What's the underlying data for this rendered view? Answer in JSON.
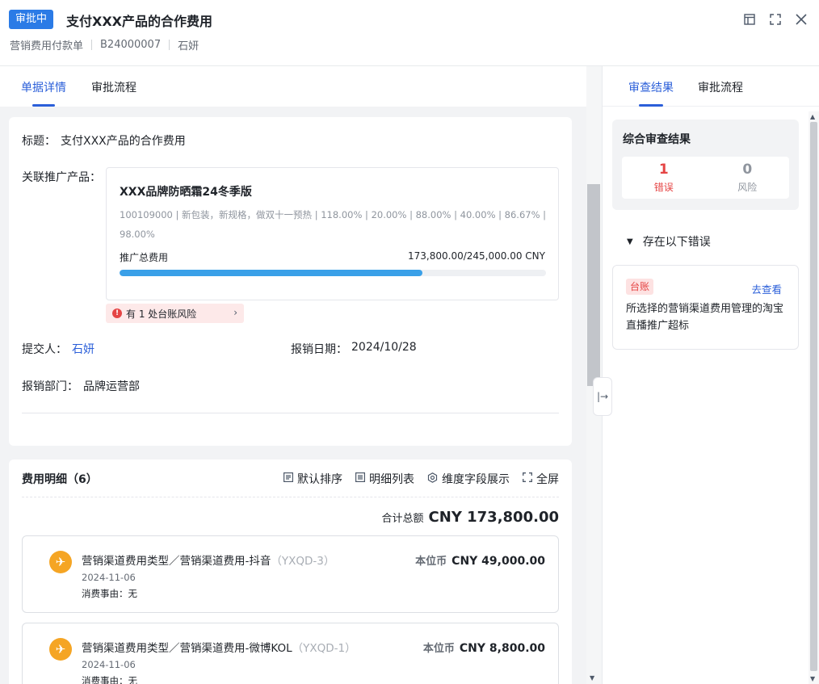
{
  "header": {
    "status": "审批中",
    "title": "支付XXX产品的合作费用",
    "doc_type": "营销费用付款单",
    "doc_no": "B24000007",
    "person": "石妍"
  },
  "left_tabs": [
    "单据详情",
    "审批流程"
  ],
  "right_tabs": [
    "审查结果",
    "审批流程"
  ],
  "basic": {
    "title_label": "标题：",
    "title_value": "支付XXX产品的合作费用",
    "product_label": "关联推广产品：",
    "product": {
      "name": "XXX品牌防晒霜24冬季版",
      "spec": "100109000 | 新包装，新规格，做双十一预热 | 118.00% | 20.00% | 88.00% | 40.00% | 86.67% | 98.00%",
      "total_label": "推广总费用",
      "total_value": "173,800.00/245,000.00 CNY",
      "progress": 0.7094
    },
    "risk_pill": "有 1 处台账风险",
    "submitter_label": "提交人：",
    "submitter_value": "石妍",
    "date_label": "报销日期：",
    "date_value": "2024/10/28",
    "dept_label": "报销部门：",
    "dept_value": "品牌运营部"
  },
  "expenses": {
    "title": "费用明细（6）",
    "tools": [
      "默认排序",
      "明细列表",
      "维度字段展示",
      "全屏"
    ],
    "total_label": "合计总额",
    "total_value": "CNY 173,800.00",
    "items": [
      {
        "title": "营销渠道费用类型／营销渠道费用-抖音",
        "code": "（YXQD-3）",
        "date": "2024-11-06",
        "reason": "消费事由：无",
        "amount_label": "本位币",
        "amount": "CNY 49,000.00"
      },
      {
        "title": "营销渠道费用类型／营销渠道费用-微博KOL",
        "code": "（YXQD-1）",
        "date": "2024-11-06",
        "reason": "消费事由：无",
        "amount_label": "本位币",
        "amount": "CNY 8,800.00"
      }
    ]
  },
  "review": {
    "summary_title": "综合审查结果",
    "error_count": "1",
    "error_label": "错误",
    "risk_count": "0",
    "risk_label": "风险",
    "error_section": "存在以下错误",
    "error_item": {
      "tag": "台账",
      "link": "去查看",
      "text": "所选择的营销渠道费用管理的淘宝直播推广超标"
    }
  }
}
